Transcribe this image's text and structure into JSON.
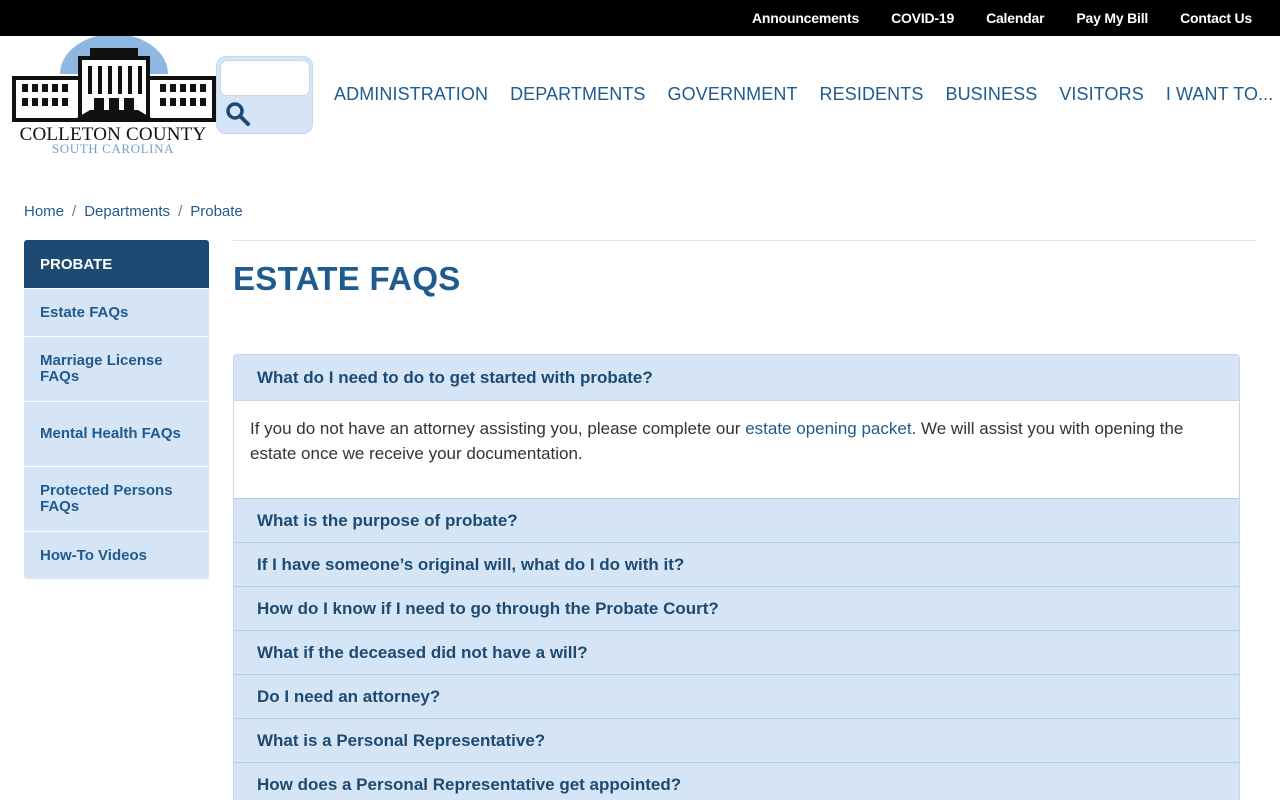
{
  "topbar": {
    "links": [
      "Announcements",
      "COVID-19",
      "Calendar",
      "Pay My Bill",
      "Contact Us"
    ]
  },
  "logo": {
    "name": "COLLETON COUNTY",
    "state": "SOUTH CAROLINA"
  },
  "search": {
    "placeholder": ""
  },
  "nav": {
    "items": [
      "ADMINISTRATION",
      "DEPARTMENTS",
      "GOVERNMENT",
      "RESIDENTS",
      "BUSINESS",
      "VISITORS",
      "I WANT TO..."
    ]
  },
  "breadcrumb": {
    "items": [
      "Home",
      "Departments",
      "Probate"
    ],
    "separator": "/"
  },
  "sidebar": {
    "title": "PROBATE",
    "items": [
      "Estate FAQs",
      "Marriage License FAQs",
      "Mental Health FAQs",
      "Protected Persons FAQs",
      "How-To Videos"
    ]
  },
  "page": {
    "title": "ESTATE FAQS"
  },
  "faq": {
    "open_question": "What do I need to do to get started with probate?",
    "answer_before_link": "If you do not have an attorney assisting you, please complete our ",
    "answer_link": "estate opening packet",
    "answer_after_link": ".  We will assist you with opening the estate once we receive your documentation.",
    "questions": [
      "What is the purpose of probate?",
      "If I have someone’s original will, what do I do with it?",
      "How do I know if I need to go through the Probate Court?",
      "What if the deceased did not have a will?",
      "Do I need an attorney?",
      "What is a Personal Representative?",
      "How does a Personal Representative get appointed?"
    ]
  },
  "colors": {
    "brand_dark": "#1d4a73",
    "brand_link": "#1f5b8f",
    "panel_light": "#d6e5f5",
    "topbar": "#000000"
  }
}
